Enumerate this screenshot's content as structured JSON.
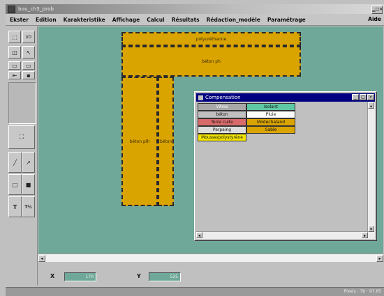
{
  "window": {
    "title": "bou_ch3_prob",
    "min_button": "▁▢✕"
  },
  "menu": {
    "items": [
      "Ekster",
      "Edition",
      "Karakteristike",
      "Affichage",
      "Calcul",
      "Résultats",
      "Rédaction_modèle",
      "Paramétrage"
    ],
    "right": "Aide"
  },
  "toolbox": {
    "tools": [
      "⬚",
      "I/O",
      "◫",
      "↖",
      "▭",
      "▭",
      "⇤",
      "▪",
      "⛶",
      "╱",
      "↗",
      "□",
      "■",
      "T",
      "T½"
    ]
  },
  "canvas": {
    "shapes": [
      {
        "label": "polyuréthanne"
      },
      {
        "label": "béton ph"
      },
      {
        "label": "béton plh"
      },
      {
        "label": "béton"
      }
    ]
  },
  "coords": {
    "x_label": "X",
    "x_value": "170",
    "y_label": "Y",
    "y_value": "525"
  },
  "status": {
    "text": "Pixels : 7b · 97.85"
  },
  "dialog": {
    "title": "Compensation",
    "materials": [
      {
        "label": "Vitres",
        "color": "#a8a8a8",
        "text_color": "#ffffff"
      },
      {
        "label": "Isolant",
        "color": "#5ec7a4",
        "text_color": "#111111"
      },
      {
        "label": "béton",
        "color": "#c0c0c0",
        "text_color": "#111111"
      },
      {
        "label": "Pluie",
        "color": "#ffffff",
        "text_color": "#111111"
      },
      {
        "label": "Terre cuite",
        "color": "#d96a6a",
        "text_color": "#111111"
      },
      {
        "label": "Modechaland",
        "color": "#d9a300",
        "text_color": "#111111"
      },
      {
        "label": "Parpaing",
        "color": "#dcdcdc",
        "text_color": "#111111"
      },
      {
        "label": "Sable",
        "color": "#d9a300",
        "text_color": "#111111"
      },
      {
        "label": "Mousse/polystyrène",
        "color": "#f4e400",
        "text_color": "#111111"
      }
    ]
  }
}
